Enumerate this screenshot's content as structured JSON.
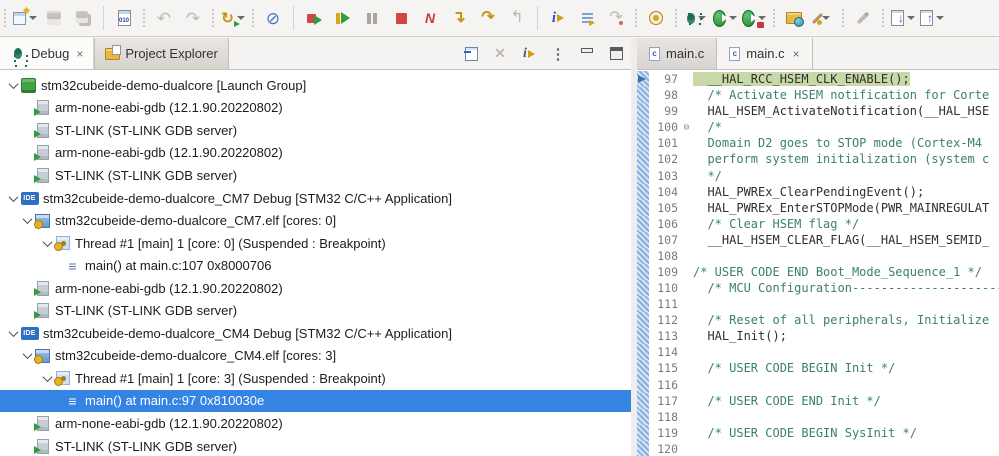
{
  "colors": {
    "selection_blue": "#3584e4",
    "execution_highlight_green": "#c9d8a8",
    "comment_teal": "#3c7f70",
    "code_text": "#2f2f2f",
    "line_number_gray": "#7b7b7b",
    "quick_diff_blue": "#7aa9dc"
  },
  "main_toolbar": {
    "items": [
      {
        "k": "handle"
      },
      {
        "k": "icon",
        "n": "new-wizard-icon",
        "chev": true
      },
      {
        "k": "icon",
        "n": "save-icon",
        "dis": true
      },
      {
        "k": "icon",
        "n": "save-all-icon",
        "dis": true
      },
      {
        "k": "sep"
      },
      {
        "k": "icon",
        "n": "binary-build-icon",
        "g": "010"
      },
      {
        "k": "handle"
      },
      {
        "k": "icon",
        "n": "undo-icon",
        "g": "↶",
        "dis": true
      },
      {
        "k": "icon",
        "n": "redo-icon",
        "g": "↷",
        "dis": true
      },
      {
        "k": "handle"
      },
      {
        "k": "icon",
        "n": "restart-icon",
        "g": "↻",
        "chev": true
      },
      {
        "k": "handle"
      },
      {
        "k": "icon",
        "n": "skip-all-breakpoints-icon",
        "g": "⊘"
      },
      {
        "k": "sep"
      },
      {
        "k": "icon",
        "n": "terminate-relaunch-icon"
      },
      {
        "k": "icon",
        "n": "resume-icon"
      },
      {
        "k": "icon",
        "n": "suspend-icon"
      },
      {
        "k": "icon",
        "n": "terminate-icon"
      },
      {
        "k": "icon",
        "n": "disconnect-icon",
        "g": "N"
      },
      {
        "k": "icon",
        "n": "step-into-icon",
        "g": "↴"
      },
      {
        "k": "icon",
        "n": "step-over-icon",
        "g": "↷"
      },
      {
        "k": "icon",
        "n": "step-return-icon",
        "g": "↰",
        "dis": true
      },
      {
        "k": "sep"
      },
      {
        "k": "icon",
        "n": "run-to-line-icon",
        "g": "i"
      },
      {
        "k": "icon",
        "n": "show-source-icon"
      },
      {
        "k": "icon",
        "n": "use-step-filters-icon",
        "g": "↷",
        "dis": true
      },
      {
        "k": "handle"
      },
      {
        "k": "icon",
        "n": "profile-icon"
      },
      {
        "k": "handle"
      },
      {
        "k": "icon",
        "n": "debug-icon",
        "chev": true
      },
      {
        "k": "icon",
        "n": "run-icon",
        "chev": true
      },
      {
        "k": "icon",
        "n": "external-tools-icon",
        "chev": true,
        "badge": true
      },
      {
        "k": "handle"
      },
      {
        "k": "icon",
        "n": "open-project-icon"
      },
      {
        "k": "icon",
        "n": "wand-icon",
        "chev": true
      },
      {
        "k": "handle"
      },
      {
        "k": "icon",
        "n": "marker-icon",
        "dis": true
      },
      {
        "k": "handle"
      },
      {
        "k": "icon",
        "n": "import-icon",
        "g": "↓",
        "chev": true
      },
      {
        "k": "icon",
        "n": "export-icon",
        "g": "↑",
        "chev": true
      }
    ]
  },
  "debug_view": {
    "tabs": [
      {
        "label": "Debug",
        "icon": "debug-bug-icon",
        "active": true,
        "closable": true,
        "close_glyph": "×"
      },
      {
        "label": "Project Explorer",
        "icon": "folder-copy-icon",
        "active": false
      }
    ],
    "toolbar": [
      {
        "n": "collapse-all-icon"
      },
      {
        "n": "remove-terminated-icon",
        "g": "✕",
        "dis": true
      },
      {
        "n": "show-execution-icon",
        "g": "i"
      },
      {
        "n": "view-menu-icon",
        "g": "⋮"
      },
      {
        "n": "minimize-icon"
      },
      {
        "n": "maximize-icon"
      }
    ],
    "tree": {
      "rows": [
        {
          "level": 0,
          "chevron": true,
          "icon": "launch-group-icon",
          "label": "stm32cubeide-demo-dualcore [Launch Group]"
        },
        {
          "level": 1,
          "icon": "gdb-process-icon",
          "label": "arm-none-eabi-gdb (12.1.90.20220802)"
        },
        {
          "level": 1,
          "icon": "gdb-process-icon",
          "label": "ST-LINK (ST-LINK GDB server)"
        },
        {
          "level": 1,
          "icon": "gdb-process-icon",
          "label": "arm-none-eabi-gdb (12.1.90.20220802)"
        },
        {
          "level": 1,
          "icon": "gdb-process-icon",
          "label": "ST-LINK (ST-LINK GDB server)"
        },
        {
          "level": 0,
          "chevron": true,
          "icon": "ide-launch-icon",
          "label": "stm32cubeide-demo-dualcore_CM7 Debug [STM32 C/C++ Application]"
        },
        {
          "level": 1,
          "chevron": true,
          "icon": "elf-executable-icon",
          "label": "stm32cubeide-demo-dualcore_CM7.elf [cores: 0]"
        },
        {
          "level": 2,
          "chevron": true,
          "icon": "thread-icon",
          "label": "Thread #1 [main] 1 [core: 0] (Suspended : Breakpoint)"
        },
        {
          "level": 3,
          "icon": "stack-frame-icon",
          "label": "main() at main.c:107 0x8000706"
        },
        {
          "level": 1,
          "icon": "gdb-process-icon",
          "label": "arm-none-eabi-gdb (12.1.90.20220802)"
        },
        {
          "level": 1,
          "icon": "gdb-process-icon",
          "label": "ST-LINK (ST-LINK GDB server)"
        },
        {
          "level": 0,
          "chevron": true,
          "icon": "ide-launch-icon",
          "label": "stm32cubeide-demo-dualcore_CM4 Debug [STM32 C/C++ Application]"
        },
        {
          "level": 1,
          "chevron": true,
          "icon": "elf-executable-icon",
          "label": "stm32cubeide-demo-dualcore_CM4.elf [cores: 3]"
        },
        {
          "level": 2,
          "chevron": true,
          "icon": "thread-icon",
          "label": "Thread #1 [main] 1 [core: 3] (Suspended : Breakpoint)"
        },
        {
          "level": 3,
          "icon": "stack-frame-icon",
          "label": "main() at main.c:97 0x810030e",
          "selected": true
        },
        {
          "level": 1,
          "icon": "gdb-process-icon",
          "label": "arm-none-eabi-gdb (12.1.90.20220802)"
        },
        {
          "level": 1,
          "icon": "gdb-process-icon",
          "label": "ST-LINK (ST-LINK GDB server)"
        }
      ]
    }
  },
  "editor": {
    "tabs": [
      {
        "label": "main.c",
        "icon": "c-file-icon",
        "active": false
      },
      {
        "label": "main.c",
        "icon": "c-file-icon",
        "active": true,
        "closable": true,
        "close_glyph": "×"
      }
    ],
    "fold_glyph": "⊖",
    "lines": [
      {
        "n": 97,
        "ptr": true,
        "hl": true,
        "segs": [
          {
            "t": "  __HAL_RCC_HSEM_CLK_ENABLE();",
            "c": "code"
          }
        ]
      },
      {
        "n": 98,
        "segs": [
          {
            "t": "  /* Activate HSEM notification for Corte",
            "c": "com"
          }
        ]
      },
      {
        "n": 99,
        "segs": [
          {
            "t": "  HAL_HSEM_ActivateNotification(__HAL_HSE",
            "c": "code"
          }
        ]
      },
      {
        "n": 100,
        "fold": true,
        "segs": [
          {
            "t": "  /*",
            "c": "com"
          }
        ]
      },
      {
        "n": 101,
        "segs": [
          {
            "t": "  Domain D2 goes to STOP mode (Cortex-M4 ",
            "c": "com"
          }
        ]
      },
      {
        "n": 102,
        "segs": [
          {
            "t": "  perform system initialization (system c",
            "c": "com"
          }
        ]
      },
      {
        "n": 103,
        "segs": [
          {
            "t": "  */",
            "c": "com"
          }
        ]
      },
      {
        "n": 104,
        "segs": [
          {
            "t": "  HAL_PWREx_ClearPendingEvent();",
            "c": "code"
          }
        ]
      },
      {
        "n": 105,
        "segs": [
          {
            "t": "  HAL_PWREx_EnterSTOPMode(PWR_MAINREGULAT",
            "c": "code"
          }
        ]
      },
      {
        "n": 106,
        "segs": [
          {
            "t": "  /* Clear HSEM flag */",
            "c": "com"
          }
        ]
      },
      {
        "n": 107,
        "segs": [
          {
            "t": "  __HAL_HSEM_CLEAR_FLAG(__HAL_HSEM_SEMID_",
            "c": "code"
          }
        ]
      },
      {
        "n": 108,
        "segs": []
      },
      {
        "n": 109,
        "segs": [
          {
            "t": "/* USER CODE END Boot_Mode_",
            "c": "com"
          },
          {
            "t": "Sequence_1",
            "c": "com",
            "u": true
          },
          {
            "t": " */",
            "c": "com"
          }
        ]
      },
      {
        "n": 110,
        "segs": [
          {
            "t": "  /* MCU Configuration---------------------",
            "c": "com"
          }
        ]
      },
      {
        "n": 111,
        "segs": []
      },
      {
        "n": 112,
        "segs": [
          {
            "t": "  /* Reset of all peripherals, Initialize",
            "c": "com"
          }
        ]
      },
      {
        "n": 113,
        "segs": [
          {
            "t": "  HAL_Init();",
            "c": "code"
          }
        ]
      },
      {
        "n": 114,
        "segs": []
      },
      {
        "n": 115,
        "segs": [
          {
            "t": "  /* USER CODE BEGIN ",
            "c": "com"
          },
          {
            "t": "Init",
            "c": "com",
            "u": true
          },
          {
            "t": " */",
            "c": "com"
          }
        ]
      },
      {
        "n": 116,
        "segs": []
      },
      {
        "n": 117,
        "segs": [
          {
            "t": "  /* USER CODE END ",
            "c": "com"
          },
          {
            "t": "Init",
            "c": "com",
            "u": true
          },
          {
            "t": " */",
            "c": "com"
          }
        ]
      },
      {
        "n": 118,
        "segs": []
      },
      {
        "n": 119,
        "segs": [
          {
            "t": "  /* USER CODE BEGIN ",
            "c": "com"
          },
          {
            "t": "SysInit",
            "c": "com",
            "u": true
          },
          {
            "t": " */",
            "c": "com"
          }
        ]
      },
      {
        "n": 120,
        "segs": []
      }
    ]
  }
}
